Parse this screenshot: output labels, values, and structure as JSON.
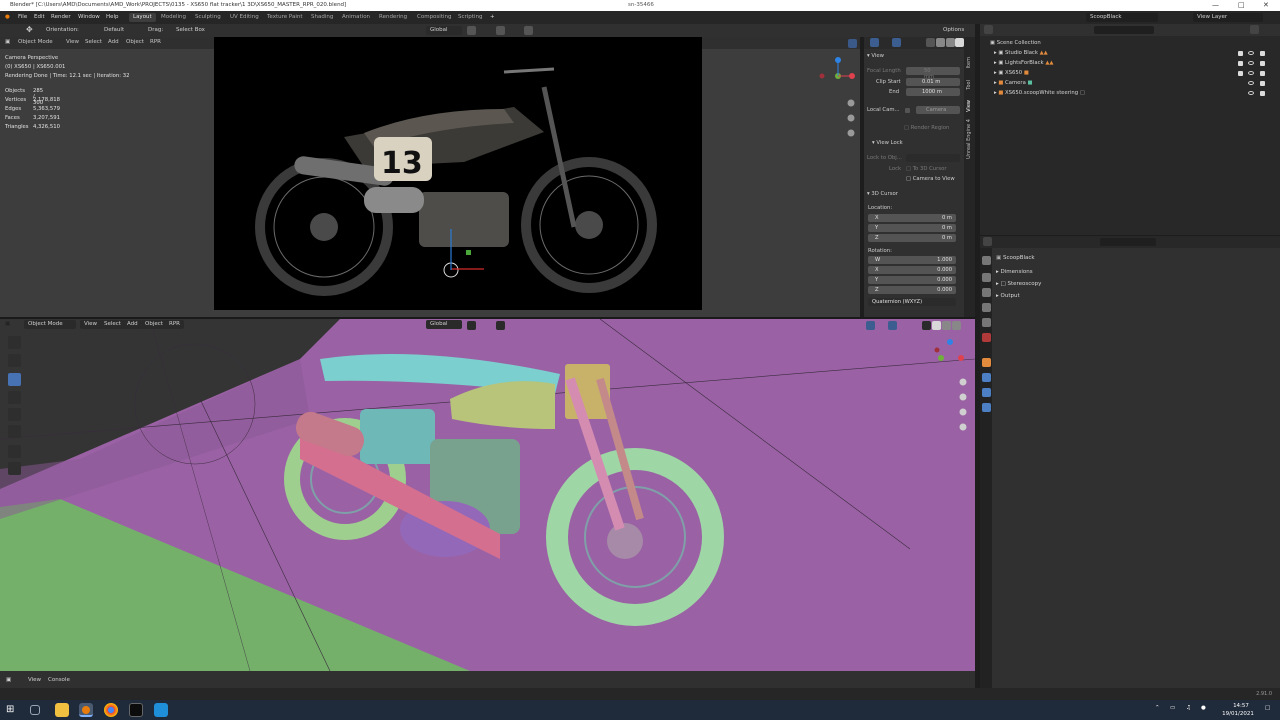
{
  "window": {
    "title": "Blender* [C:\\Users\\AMD\\Documents\\AMD_Work\\PROJECTS\\0135 - XS650 flat tracker\\1 3D\\XS650_MASTER_RPR_020.blend]",
    "center_text": "sn-35466"
  },
  "menu": {
    "items": [
      "File",
      "Edit",
      "Render",
      "Window",
      "Help"
    ],
    "workspaces": [
      "Layout",
      "Modeling",
      "Sculpting",
      "UV Editing",
      "Texture Paint",
      "Shading",
      "Animation",
      "Rendering",
      "Compositing",
      "Scripting"
    ],
    "active_workspace": "Layout",
    "scene": "ScoopBlack",
    "view_layer": "View Layer"
  },
  "tool_header": {
    "orientation_label": "Orientation:",
    "orientation_value": "Default",
    "drag_label": "Drag:",
    "drag_value": "Select Box",
    "transform_orientation": "Global",
    "options": "Options"
  },
  "upper_viewport": {
    "mode": "Object Mode",
    "menus": [
      "View",
      "Select",
      "Add",
      "Object",
      "RPR"
    ],
    "overlay_title": "Camera Perspective",
    "overlay_object": "(0) XS650 | XS650.001",
    "render_info": "Rendering Done | Time: 12.1 sec | Iteration: 32",
    "stats": [
      {
        "label": "Objects",
        "value": "285 / 300"
      },
      {
        "label": "Vertices",
        "value": "2,178,818"
      },
      {
        "label": "Edges",
        "value": "5,363,579"
      },
      {
        "label": "Faces",
        "value": "3,207,591"
      },
      {
        "label": "Triangles",
        "value": "4,326,510"
      }
    ],
    "race_number": "13"
  },
  "n_panel": {
    "view_header": "View",
    "focal_length_label": "Focal Length",
    "focal_length_value": "50 mm",
    "clip_start_label": "Clip Start",
    "clip_start_value": "0.01 m",
    "clip_end_label": "End",
    "clip_end_value": "1000 m",
    "local_camera_label": "Local Cam...",
    "local_camera_value": "Camera",
    "render_region": "Render Region",
    "view_lock_header": "View Lock",
    "lock_to_object_label": "Lock to Obj...",
    "lock_label": "Lock",
    "to_3d_cursor": "To 3D Cursor",
    "camera_to_view": "Camera to View",
    "cursor_header": "3D Cursor",
    "location_label": "Location:",
    "loc": [
      {
        "axis": "X",
        "value": "0 m"
      },
      {
        "axis": "Y",
        "value": "0 m"
      },
      {
        "axis": "Z",
        "value": "0 m"
      }
    ],
    "rotation_label": "Rotation:",
    "rot": [
      {
        "axis": "W",
        "value": "1.000"
      },
      {
        "axis": "X",
        "value": "0.000"
      },
      {
        "axis": "Y",
        "value": "0.000"
      },
      {
        "axis": "Z",
        "value": "0.000"
      }
    ],
    "rotation_mode": "Quaternion (WXYZ)",
    "tabs": [
      "Item",
      "Tool",
      "View",
      "Unreal Engine 4"
    ]
  },
  "lower_viewport": {
    "mode": "Object Mode",
    "menus": [
      "View",
      "Select",
      "Add",
      "Object",
      "RPR"
    ],
    "transform_orientation": "Global"
  },
  "outliner": {
    "root": "Scene Collection",
    "items": [
      "Studio Black",
      "LightsForBlack",
      "XS650",
      "Camera",
      "XS650.scoopWhite steering"
    ]
  },
  "properties": {
    "scene_name": "ScoopBlack",
    "panels": [
      "Dimensions",
      "Stereoscopy",
      "Output"
    ]
  },
  "console": {
    "menus": [
      "View",
      "Console"
    ]
  },
  "statusbar": {
    "version": "2.91.0"
  },
  "taskbar": {
    "time": "14:57",
    "date": "19/01/2021"
  }
}
